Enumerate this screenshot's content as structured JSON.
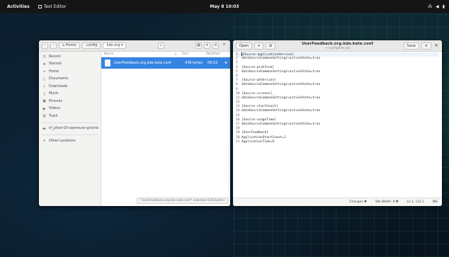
{
  "topbar": {
    "activities": "Activities",
    "app_name": "Text Editor",
    "clock": "May 8  10:03",
    "tray": [
      "network-icon",
      "volume-icon",
      "battery-icon"
    ]
  },
  "file_manager": {
    "breadcrumbs": [
      "Home",
      ".config",
      "kde.org"
    ],
    "sidebar": [
      {
        "icon": "clock-icon",
        "glyph": "◷",
        "label": "Recent"
      },
      {
        "icon": "star-icon",
        "glyph": "★",
        "label": "Starred"
      },
      {
        "icon": "home-icon",
        "glyph": "⌂",
        "label": "Home"
      },
      {
        "icon": "document-icon",
        "glyph": "▯",
        "label": "Documents"
      },
      {
        "icon": "download-icon",
        "glyph": "↓",
        "label": "Downloads"
      },
      {
        "icon": "music-icon",
        "glyph": "♫",
        "label": "Music"
      },
      {
        "icon": "picture-icon",
        "glyph": "▣",
        "label": "Pictures"
      },
      {
        "icon": "video-icon",
        "glyph": "▶",
        "label": "Videos"
      },
      {
        "icon": "trash-icon",
        "glyph": "▥",
        "label": "Trash"
      },
      {
        "icon": "drive-icon",
        "glyph": "▬",
        "label": "vf_phanr10-opensuse-gnome"
      },
      {
        "icon": "plus-icon",
        "glyph": "+",
        "label": "Other Locations"
      }
    ],
    "columns": {
      "name": "Name",
      "size": "Size",
      "modified": "Modified"
    },
    "rows": [
      {
        "name": "UserFeedback.org.kde.kate.conf",
        "size": "436 bytes",
        "modified": "09:52"
      }
    ],
    "status": "\"UserFeedback.org.kde.kate.conf\" selected (436 bytes)"
  },
  "editor": {
    "open_label": "Open",
    "save_label": "Save",
    "title": "UserFeedback.org.kde.kate.conf",
    "subtitle": "~/.config/kde.org",
    "lines": [
      {
        "n": "1",
        "t": "[Source-applicationVersion]"
      },
      {
        "n": "2",
        "t": "dataSourceCommonSettings\\activeState=true"
      },
      {
        "n": "3",
        "t": ""
      },
      {
        "n": "4",
        "t": "[Source-platform]"
      },
      {
        "n": "5",
        "t": "dataSourceCommonSettings\\activeState=true"
      },
      {
        "n": "6",
        "t": ""
      },
      {
        "n": "7",
        "t": "[Source-qtVersion]"
      },
      {
        "n": "8",
        "t": "dataSourceCommonSettings\\activeState=true"
      },
      {
        "n": "9",
        "t": ""
      },
      {
        "n": "10",
        "t": "[Source-screens]"
      },
      {
        "n": "11",
        "t": "dataSourceCommonSettings\\activeState=true"
      },
      {
        "n": "12",
        "t": ""
      },
      {
        "n": "13",
        "t": "[Source-startCount]"
      },
      {
        "n": "14",
        "t": "dataSourceCommonSettings\\activeState=true"
      },
      {
        "n": "15",
        "t": ""
      },
      {
        "n": "16",
        "t": "[Source-usageTime]"
      },
      {
        "n": "17",
        "t": "dataSourceCommonSettings\\activeState=true"
      },
      {
        "n": "18",
        "t": ""
      },
      {
        "n": "19",
        "t": "[UserFeedback]"
      },
      {
        "n": "20",
        "t": "ApplicationStartCount=1"
      },
      {
        "n": "21",
        "t": "ApplicationTime=9"
      }
    ],
    "status": {
      "changes": "Changes ▼",
      "tab_width": "Tab Width: 8 ▼",
      "position": "Ln 1, Col 1",
      "mode": "INS"
    }
  }
}
